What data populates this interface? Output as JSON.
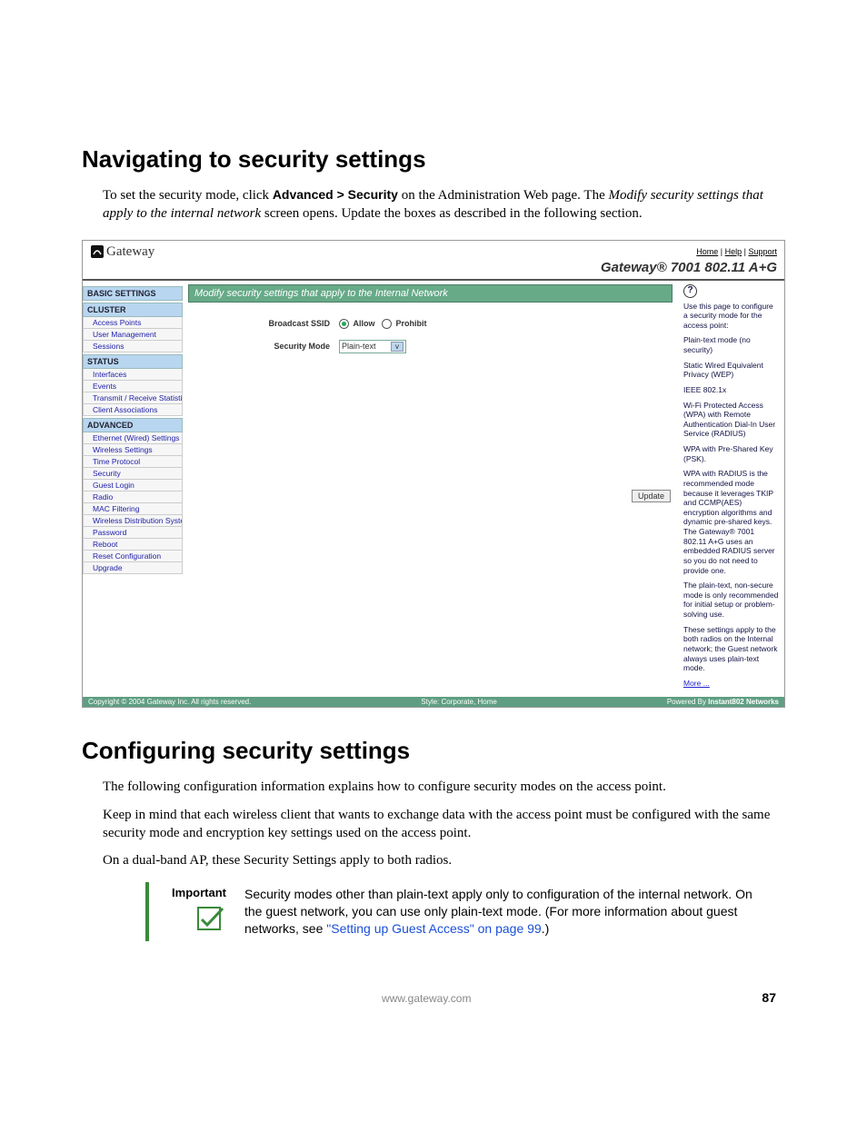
{
  "headings": {
    "h1_nav": "Navigating to security settings",
    "h1_conf": "Configuring security settings"
  },
  "para": {
    "nav_1a": "To set the security mode, click ",
    "nav_1b": "Advanced > Security",
    "nav_1c": " on the Administration Web page. The ",
    "nav_1d": "Modify security settings that apply to the internal network",
    "nav_1e": " screen opens. Update the boxes as described in the following section.",
    "conf_1": "The following configuration information explains how to configure security modes on the access point.",
    "conf_2": "Keep in mind that each wireless client that wants to exchange data with the access point must be configured with the same security mode and encryption key settings used on the access point.",
    "conf_3": "On a dual-band AP, these Security Settings apply to both radios."
  },
  "screenshot": {
    "logo_text": "Gateway",
    "toplinks": {
      "home": "Home",
      "help": "Help",
      "support": "Support"
    },
    "model": "Gateway® 7001 802.11 A+G",
    "nav_headers": {
      "basic": "BASIC SETTINGS",
      "cluster": "CLUSTER",
      "status": "STATUS",
      "advanced": "ADVANCED"
    },
    "nav": {
      "cluster": [
        "Access Points",
        "User Management",
        "Sessions"
      ],
      "status": [
        "Interfaces",
        "Events",
        "Transmit / Receive Statistics",
        "Client Associations"
      ],
      "advanced": [
        "Ethernet (Wired) Settings",
        "Wireless Settings",
        "Time Protocol",
        "Security",
        "Guest Login",
        "Radio",
        "MAC Filtering",
        "Wireless Distribution System",
        "Password",
        "Reboot",
        "Reset Configuration",
        "Upgrade"
      ]
    },
    "main_title": "Modify security settings that apply to the Internal Network",
    "form": {
      "broadcast_label": "Broadcast SSID",
      "allow": "Allow",
      "prohibit": "Prohibit",
      "mode_label": "Security Mode",
      "mode_value": "Plain-text",
      "update": "Update"
    },
    "help": {
      "p1": "Use this page to configure a security mode for the access point:",
      "p2": "Plain-text mode (no security)",
      "p3": "Static Wired Equivalent Privacy (WEP)",
      "p4": "IEEE 802.1x",
      "p5": "Wi-Fi Protected Access (WPA) with Remote Authentication Dial-In User Service (RADIUS)",
      "p6": "WPA with Pre-Shared Key (PSK).",
      "p7": "WPA with RADIUS is the recommended mode because it leverages TKIP and CCMP(AES) encryption algorithms and dynamic pre-shared keys. The Gateway® 7001 802.11 A+G uses an embedded RADIUS server so you do not need to provide one.",
      "p8": "The plain-text, non-secure mode is only recommended for initial setup or problem-solving use.",
      "p9": "These settings apply to the both radios on the Internal network; the Guest network always uses plain-text mode.",
      "more": "More ..."
    },
    "footer": {
      "left": "Copyright © 2004 Gateway Inc. All rights reserved.",
      "mid": "Style: Corporate, Home",
      "right_a": "Powered By ",
      "right_b": "Instant802 Networks"
    }
  },
  "important": {
    "label": "Important",
    "text_a": "Security modes other than plain-text apply only to configuration of the internal network. On the guest network, you can use only plain-text mode. (For more information about guest networks, see ",
    "link": "\"Setting up Guest Access\" on page 99",
    "text_b": ".)"
  },
  "footer": {
    "url": "www.gateway.com",
    "page": "87"
  }
}
